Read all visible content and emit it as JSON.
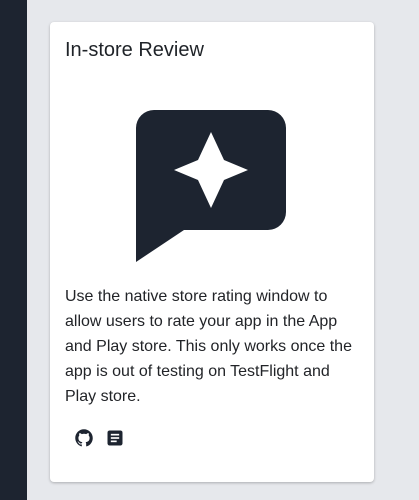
{
  "card": {
    "title": "In-store Review",
    "icon": "sparkle-chat-bubble-icon",
    "description": "Use the native store rating window to allow users to rate your app in the App and Play store. This only works once the app is out of testing on TestFlight and Play store.",
    "actions": [
      {
        "icon": "github-icon"
      },
      {
        "icon": "docs-icon"
      }
    ]
  },
  "colors": {
    "sidebar": "#1d2430",
    "card_icon": "#1d2430",
    "background": "#e6e8ec",
    "text": "#222428"
  }
}
